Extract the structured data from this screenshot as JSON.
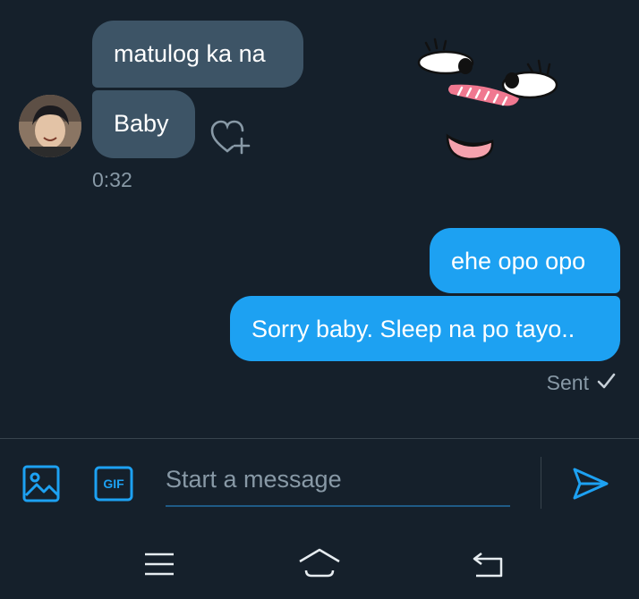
{
  "thread": {
    "incoming": [
      {
        "text": "matulog ka na"
      },
      {
        "text": "Baby"
      }
    ],
    "incoming_time": "0:32",
    "outgoing": [
      {
        "text": "ehe opo opo"
      },
      {
        "text": "Sorry baby. Sleep na po tayo.."
      }
    ],
    "sent_status": "Sent"
  },
  "composer": {
    "placeholder": "Start a message",
    "gif_label": "GIF"
  },
  "colors": {
    "background": "#15202b",
    "incoming_bubble": "#3d5466",
    "outgoing_bubble": "#1da1f2",
    "accent": "#1da1f2",
    "muted_text": "#8899a6"
  },
  "icons": [
    "heart-plus-icon",
    "image-icon",
    "gif-icon",
    "send-icon",
    "menu-icon",
    "home-icon",
    "back-icon",
    "checkmark-icon"
  ]
}
